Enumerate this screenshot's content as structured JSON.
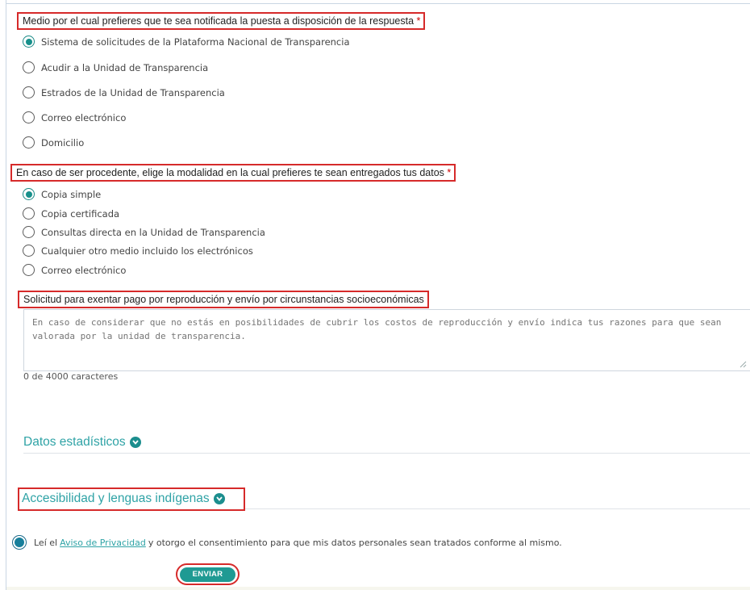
{
  "notification": {
    "label": "Medio por el cual prefieres que te sea notificada la puesta a disposición de la respuesta",
    "required": "*",
    "options": [
      "Sistema de solicitudes de la Plataforma Nacional de Transparencia",
      "Acudir a la Unidad de Transparencia",
      "Estrados de la Unidad de Transparencia",
      "Correo electrónico",
      "Domicilio"
    ],
    "selected_index": 0
  },
  "modality": {
    "label": "En caso de ser procedente, elige la modalidad en la cual prefieres te sean entregados tus datos",
    "required": "*",
    "options": [
      "Copia simple",
      "Copia certificada",
      "Consultas directa en la Unidad de Transparencia",
      "Cualquier otro medio incluido los electrónicos",
      "Correo electrónico"
    ],
    "selected_index": 0
  },
  "exemption": {
    "label": "Solicitud para exentar pago por reproducción y envío por circunstancias socioeconómicas",
    "placeholder": "En caso de considerar que no estás en posibilidades de cubrir los costos de reproducción y envío indica tus razones para que sean valorada por la unidad de transparencia.",
    "counter": "0 de 4000 caracteres"
  },
  "sections": {
    "statistics": "Datos estadísticos",
    "accessibility": "Accesibilidad y lenguas indígenas"
  },
  "privacy": {
    "prefix": "Leí el",
    "link": "Aviso de Privacidad",
    "suffix": "y otorgo el consentimiento para que mis datos personales sean tratados conforme al mismo.",
    "checked": true
  },
  "submit": {
    "label": "ENVIAR"
  },
  "colors": {
    "accent": "#17908b",
    "highlight_border": "#d62a2a",
    "section_title": "#2fa3a6"
  }
}
